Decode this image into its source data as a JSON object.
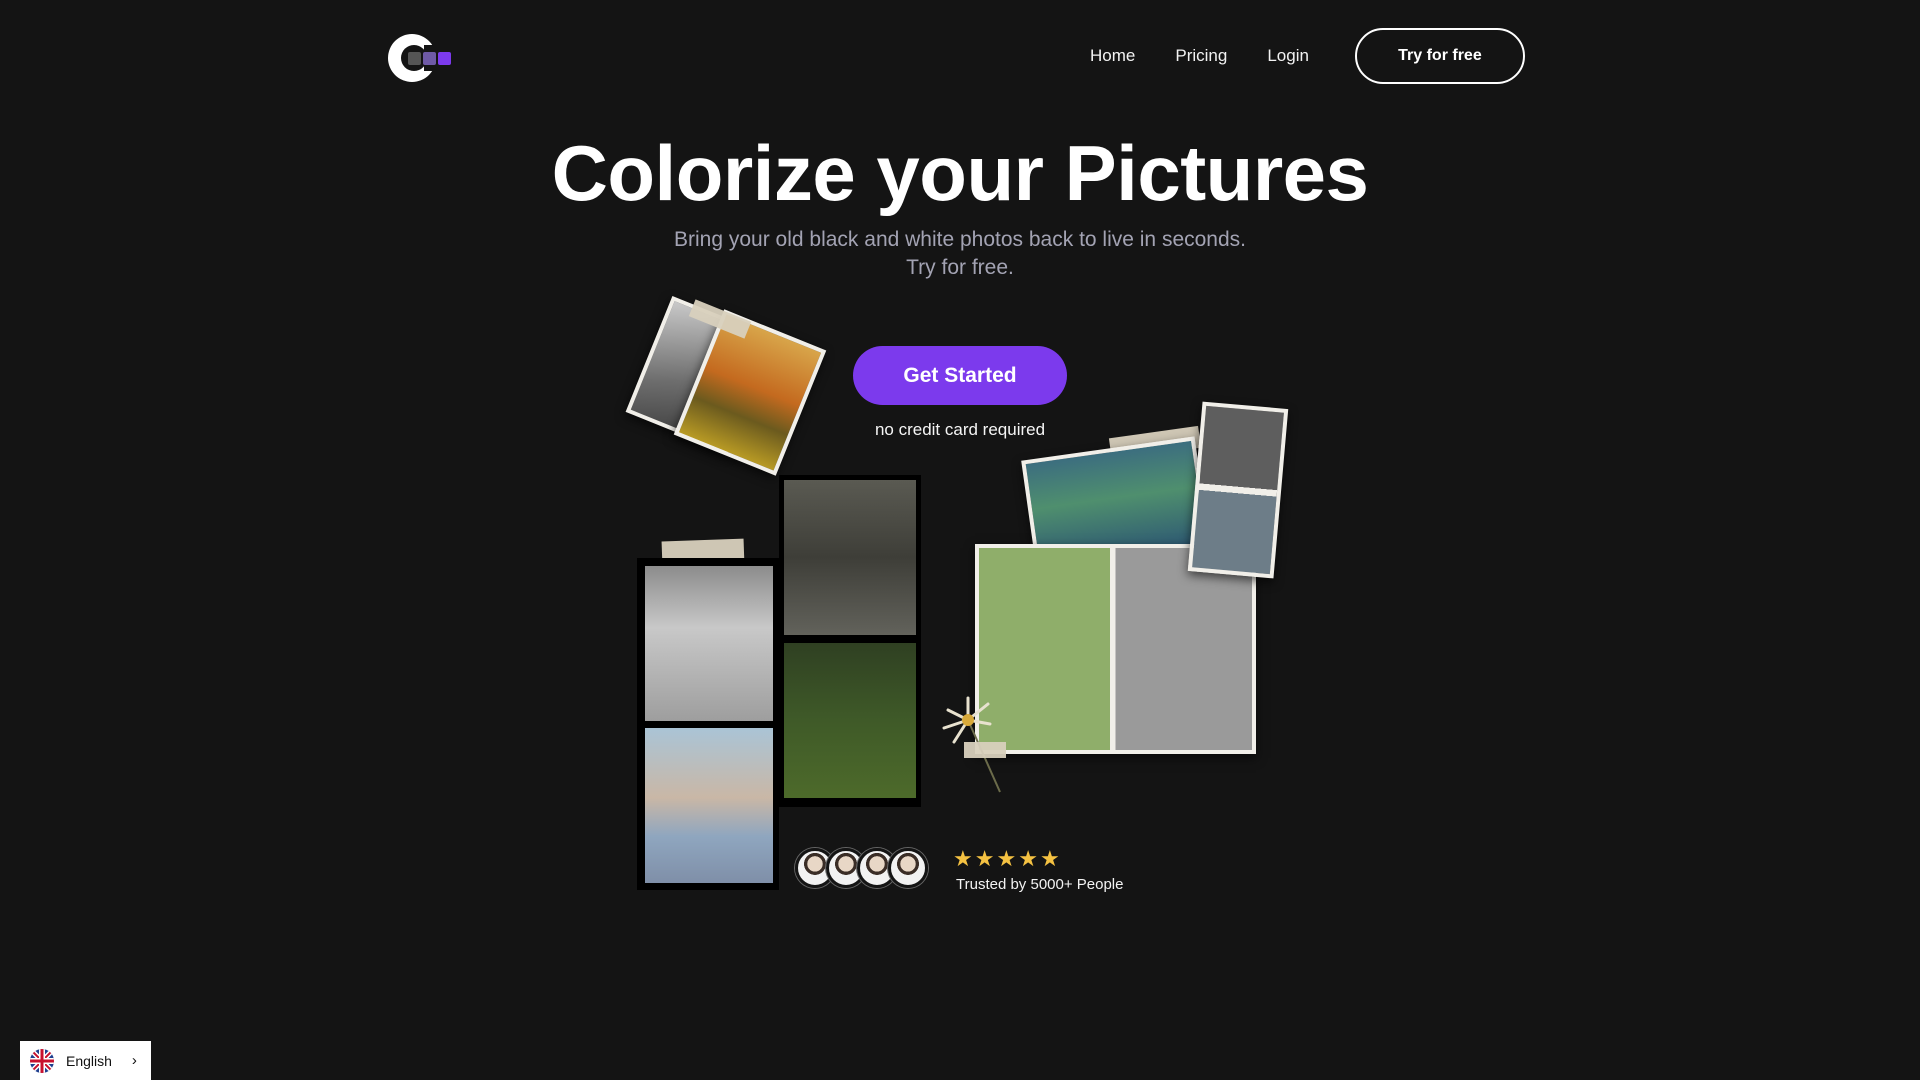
{
  "header": {
    "logo_name": "logo",
    "nav": [
      {
        "label": "Home"
      },
      {
        "label": "Pricing"
      },
      {
        "label": "Login"
      }
    ],
    "cta_label": "Try for free"
  },
  "hero": {
    "title": "Colorize your Pictures",
    "subtitle_line1": "Bring your old black and white photos back to live in seconds.",
    "subtitle_line2": "Try for free.",
    "cta_label": "Get Started",
    "cta_note": "no credit card required"
  },
  "trust": {
    "rating_stars": 5,
    "text": "Trusted by 5000+ People",
    "avatar_count": 4
  },
  "language": {
    "label": "English",
    "flag": "uk-flag-icon"
  },
  "colors": {
    "background": "#141414",
    "accent": "#7c3aed",
    "star": "#f5c242"
  }
}
